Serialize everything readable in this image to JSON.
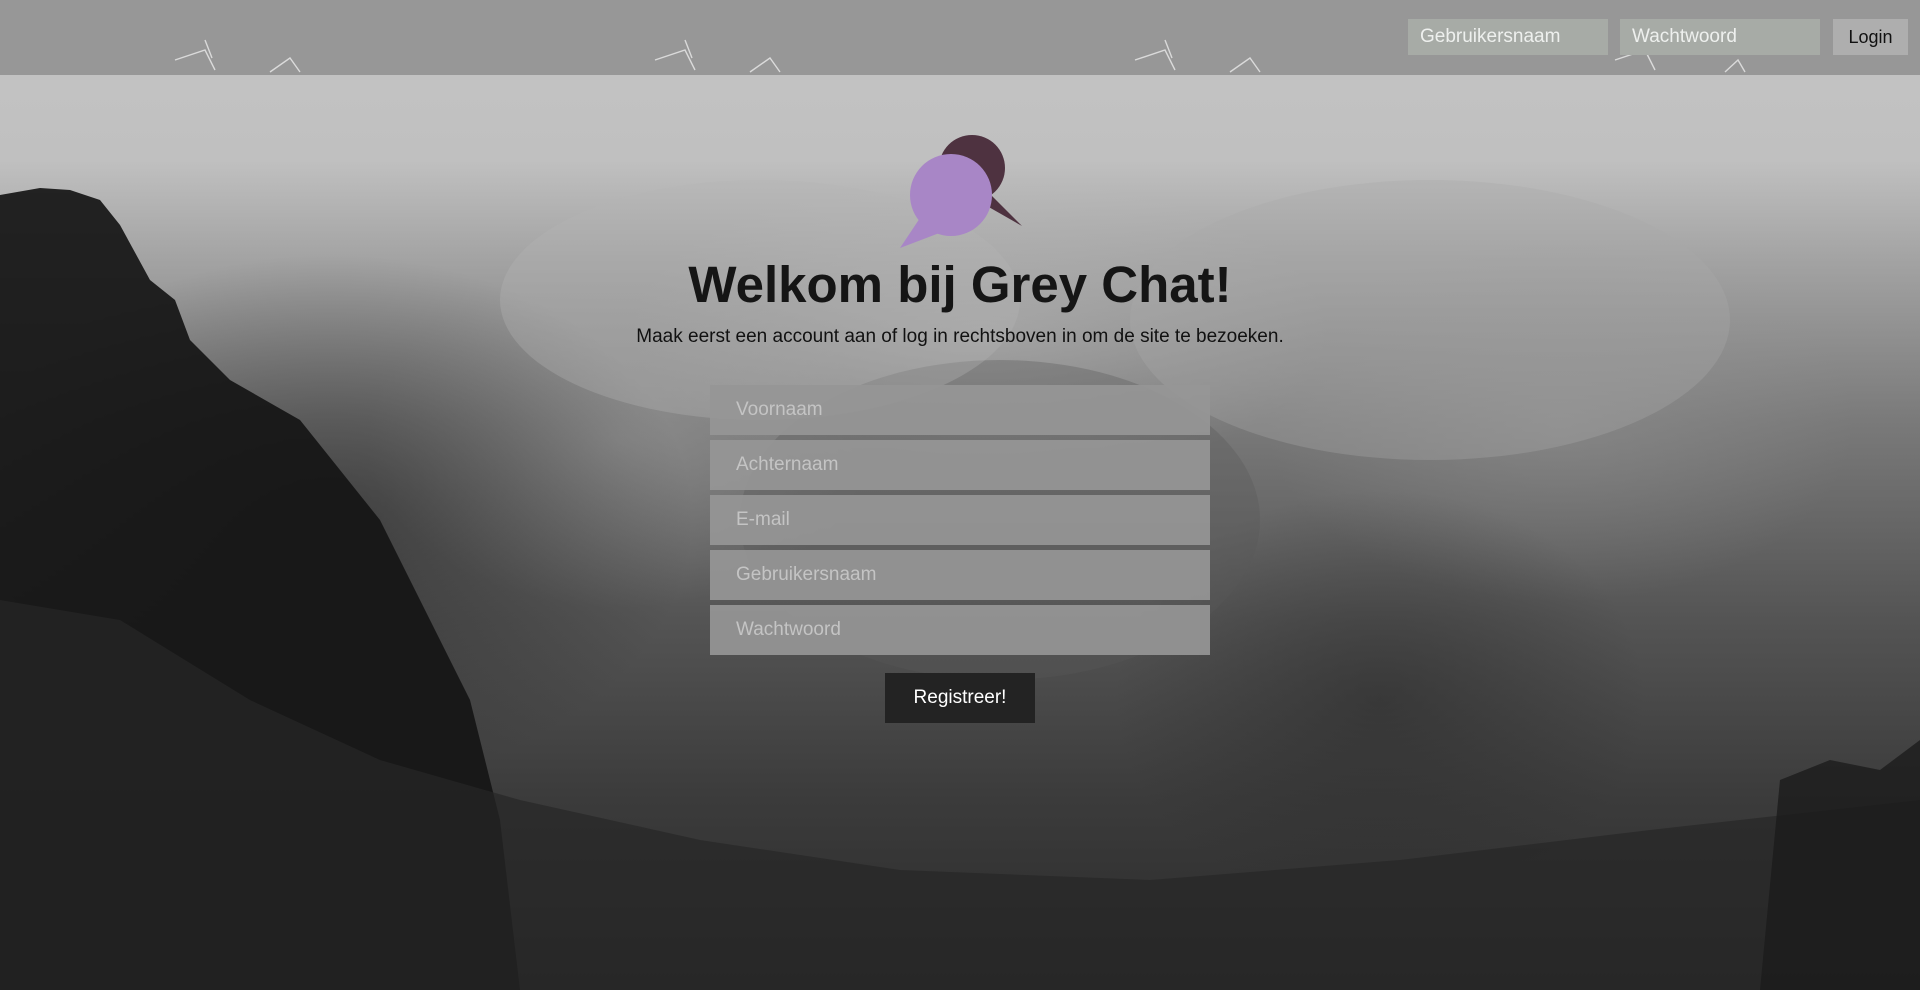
{
  "header": {
    "username_placeholder": "Gebruikersnaam",
    "password_placeholder": "Wachtwoord",
    "login_label": "Login"
  },
  "main": {
    "logo_icon": "chat-bubbles-icon",
    "title": "Welkom bij Grey Chat!",
    "subtitle": "Maak eerst een account aan of log in rechtsboven in om de site te bezoeken."
  },
  "register_form": {
    "fields": [
      {
        "placeholder": "Voornaam",
        "value": ""
      },
      {
        "placeholder": "Achternaam",
        "value": ""
      },
      {
        "placeholder": "E-mail",
        "value": ""
      },
      {
        "placeholder": "Gebruikersnaam",
        "value": ""
      },
      {
        "placeholder": "Wachtwoord",
        "value": ""
      }
    ],
    "submit_label": "Registreer!"
  },
  "colors": {
    "topbar": "#979797",
    "logo_front": "#a886c6",
    "logo_back": "#4e3240",
    "register_button": "#232323"
  }
}
